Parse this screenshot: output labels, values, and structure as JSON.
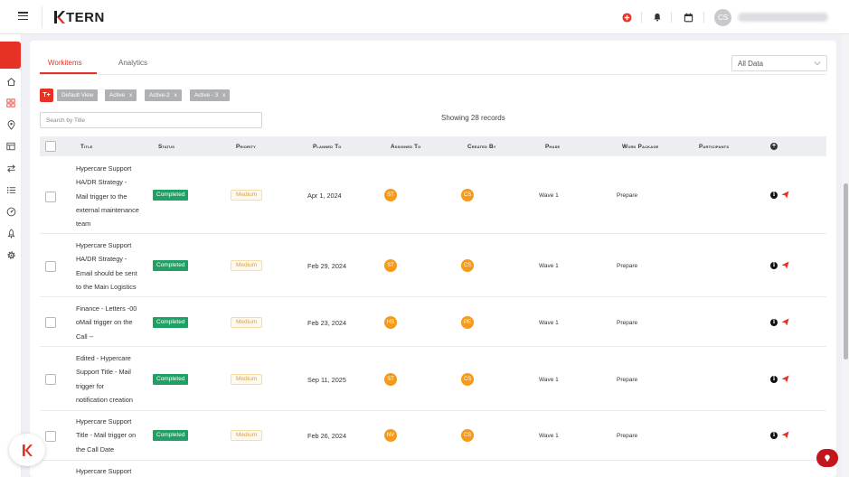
{
  "header": {
    "logo_text": "TERN",
    "logo_letter": "K",
    "user_initials": "CS",
    "colors": {
      "brand": "#e53224",
      "help": "#c3161c"
    }
  },
  "sidebar": {
    "items": [
      "home-icon",
      "dashboard-icon",
      "location-icon",
      "board-icon",
      "transfer-icon",
      "list-icon",
      "gauge-icon",
      "rocket-icon",
      "settings-icon"
    ]
  },
  "tabs": [
    {
      "label": "Workitems",
      "active": true
    },
    {
      "label": "Analytics",
      "active": false
    }
  ],
  "data_filter": {
    "selected": "All Data"
  },
  "view_chips": [
    "Default View",
    "Active",
    "Active-2",
    "Active - 3"
  ],
  "add_button_label": "T+",
  "search": {
    "placeholder": "Search by Title",
    "value": ""
  },
  "records_text": "Showing 28 records",
  "table": {
    "headers": [
      "Title",
      "Status",
      "Priority",
      "Planned To",
      "Assigned To",
      "Created By",
      "Phase",
      "Work Package",
      "Participants"
    ],
    "rows": [
      {
        "title_lines": [
          "Hypercare Support",
          "HA/DR Strategy -",
          "Mail trigger to the",
          "external maintenance",
          "team"
        ],
        "status": "Completed",
        "priority": "Medium",
        "planned_to": "Apr 1, 2024",
        "assigned_to": "ST",
        "created_by": "CS",
        "phase": "Wave 1",
        "work_package": "Prepare"
      },
      {
        "title_lines": [
          "Hypercare Support",
          "HA/DR Strategy -",
          "Email should be sent",
          "to the Main Logistics"
        ],
        "status": "Completed",
        "priority": "Medium",
        "planned_to": "Feb 29, 2024",
        "assigned_to": "ST",
        "created_by": "CS",
        "phase": "Wave 1",
        "work_package": "Prepare"
      },
      {
        "title_lines": [
          "Finance - Letters -00",
          "oMail trigger on the",
          "Call --"
        ],
        "status": "Completed",
        "priority": "Medium",
        "planned_to": "Feb 23, 2024",
        "assigned_to": "HS",
        "created_by": "PE",
        "phase": "Wave 1",
        "work_package": "Prepare"
      },
      {
        "title_lines": [
          "Edited - Hypercare",
          "Support Title - Mail",
          "trigger for",
          "notification creation"
        ],
        "status": "Completed",
        "priority": "Medium",
        "planned_to": "Sep 11, 2025",
        "assigned_to": "ST",
        "created_by": "CS",
        "phase": "Wave 1",
        "work_package": "Prepare"
      },
      {
        "title_lines": [
          "Hypercare Support",
          "Title - Mail trigger on",
          "the Call Date"
        ],
        "status": "Completed",
        "priority": "Medium",
        "planned_to": "Feb 26, 2024",
        "assigned_to": "NV",
        "created_by": "CS",
        "phase": "Wave 1",
        "work_package": "Prepare"
      },
      {
        "title_lines": [
          "Hypercare Support"
        ],
        "status": "",
        "priority": "",
        "planned_to": "",
        "assigned_to": "",
        "created_by": "",
        "phase": "",
        "work_package": ""
      }
    ]
  }
}
